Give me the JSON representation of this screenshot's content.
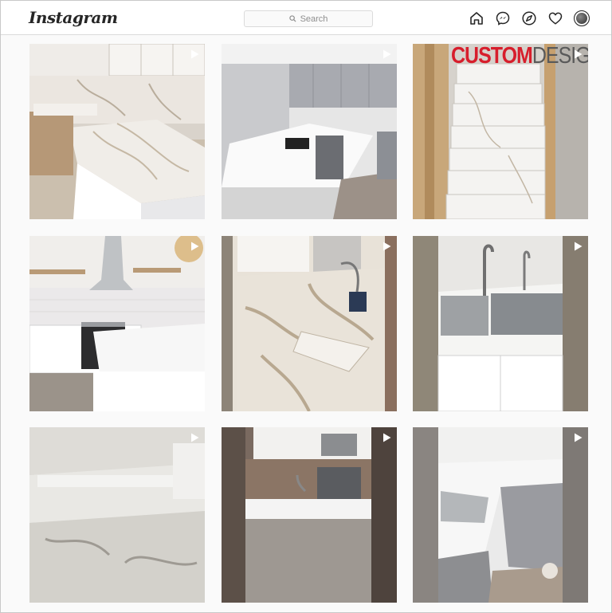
{
  "header": {
    "logo": "Instagram",
    "search": {
      "placeholder": "Search"
    },
    "nav_icons": [
      "home-icon",
      "messenger-icon",
      "explore-icon",
      "heart-icon",
      "profile-avatar"
    ]
  },
  "colors": {
    "background": "#fafafa",
    "header_bg": "#ffffff",
    "border": "#dbdbdb",
    "text": "#262626",
    "muted": "#8e8e8e",
    "overlay_red": "#d71e2c"
  },
  "posts": [
    {
      "type": "video",
      "subject": "white quartz kitchen counter with cabinets"
    },
    {
      "type": "video",
      "subject": "kitchen island with grey cabinets"
    },
    {
      "type": "video",
      "subject": "marble stairs",
      "overlay": {
        "part1": "CUSTOM",
        "part2": "DESIGN"
      }
    },
    {
      "type": "video",
      "subject": "kitchen with range hood and shelves"
    },
    {
      "type": "video",
      "subject": "veined quartz countertop with sink"
    },
    {
      "type": "video",
      "subject": "stainless steel double sink"
    },
    {
      "type": "video",
      "subject": "slab cutting"
    },
    {
      "type": "video",
      "subject": "kitchen with microwave and stove"
    },
    {
      "type": "video",
      "subject": "l-shaped counter with grey cabinets"
    }
  ]
}
